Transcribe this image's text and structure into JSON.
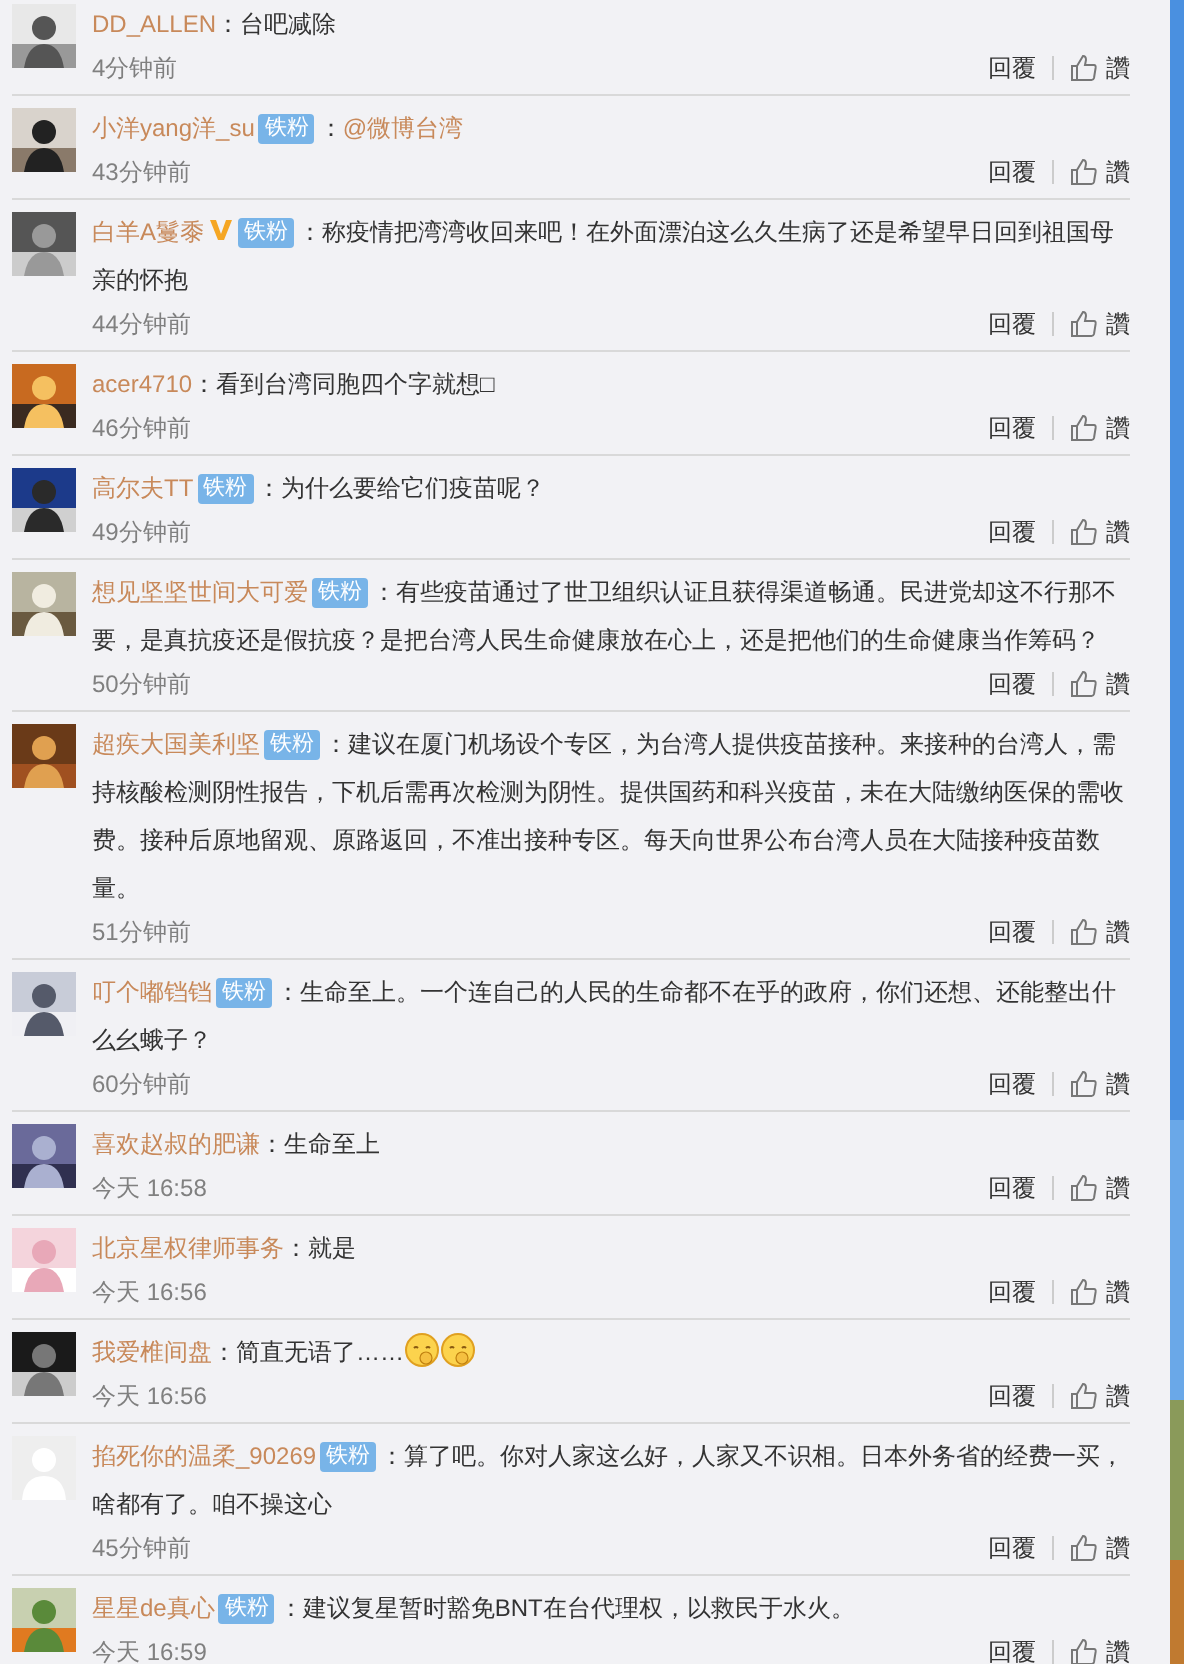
{
  "comments": [
    {
      "user": "DD_ALLEN",
      "vip": false,
      "text": "：台吧减除",
      "time": "4分钟前",
      "reply": "回覆",
      "like": "讚"
    },
    {
      "user": "小洋yang洋_su",
      "vip": false,
      "badge": "铁粉",
      "text": "：",
      "mention": "@微博台湾",
      "time": "43分钟前",
      "reply": "回覆",
      "like": "讚"
    },
    {
      "user": "白羊A鬘黍",
      "vip": true,
      "badge": "铁粉",
      "text": "：称疫情把湾湾收回来吧！在外面漂泊这么久生病了还是希望早日回到祖国母亲的怀抱",
      "time": "44分钟前",
      "reply": "回覆",
      "like": "讚"
    },
    {
      "user": "acer4710",
      "vip": false,
      "text": "：看到台湾同胞四个字就想□",
      "time": "46分钟前",
      "reply": "回覆",
      "like": "讚"
    },
    {
      "user": "高尔夫TT",
      "vip": false,
      "badge": "铁粉",
      "text": "：为什么要给它们疫苗呢？",
      "time": "49分钟前",
      "reply": "回覆",
      "like": "讚"
    },
    {
      "user": "想见坚坚世间大可爱",
      "vip": false,
      "badge": "铁粉",
      "text": "：有些疫苗通过了世卫组织认证且获得渠道畅通。民进党却这不行那不要，是真抗疫还是假抗疫？是把台湾人民生命健康放在心上，还是把他们的生命健康当作筹码？",
      "time": "50分钟前",
      "reply": "回覆",
      "like": "讚"
    },
    {
      "user": "超疾大国美利坚",
      "vip": false,
      "badge": "铁粉",
      "text": "：建议在厦门机场设个专区，为台湾人提供疫苗接种。来接种的台湾人，需持核酸检测阴性报告，下机后需再次检测为阴性。提供国药和科兴疫苗，未在大陆缴纳医保的需收费。接种后原地留观、原路返回，不准出接种专区。每天向世界公布台湾人员在大陆接种疫苗数量。",
      "time": "51分钟前",
      "reply": "回覆",
      "like": "讚"
    },
    {
      "user": "叮个嘟铛铛",
      "vip": false,
      "badge": "铁粉",
      "text": "：生命至上。一个连自己的人民的生命都不在乎的政府，你们还想、还能整出什么幺蛾子？",
      "time": "60分钟前",
      "reply": "回覆",
      "like": "讚"
    },
    {
      "user": "喜欢赵叔的肥谦",
      "vip": false,
      "text": "：生命至上",
      "time": "今天 16:58",
      "reply": "回覆",
      "like": "讚"
    },
    {
      "user": "北京星权律师事务",
      "vip": false,
      "text": "：就是",
      "time": "今天 16:56",
      "reply": "回覆",
      "like": "讚"
    },
    {
      "user": "我爱椎间盘",
      "vip": false,
      "text": "：简直无语了……",
      "emojis": [
        {
          "kind": "face"
        },
        {
          "kind": "face"
        }
      ],
      "time": "今天 16:56",
      "reply": "回覆",
      "like": "讚"
    },
    {
      "user": "掐死你的温柔_90269",
      "avatar": {
        "kind": "default"
      },
      "vip": false,
      "badge": "铁粉",
      "text": "：算了吧。你对人家这么好，人家又不识相。日本外务省的经费一买，啥都有了。咱不操这心",
      "time": "45分钟前",
      "reply": "回覆",
      "like": "讚"
    },
    {
      "user": "星星de真心",
      "vip": false,
      "badge": "铁粉",
      "text": "：建议复星暂时豁免BNT在台代理权，以救民于水火。",
      "time": "今天 16:59",
      "reply": "回覆",
      "like": "讚"
    }
  ]
}
